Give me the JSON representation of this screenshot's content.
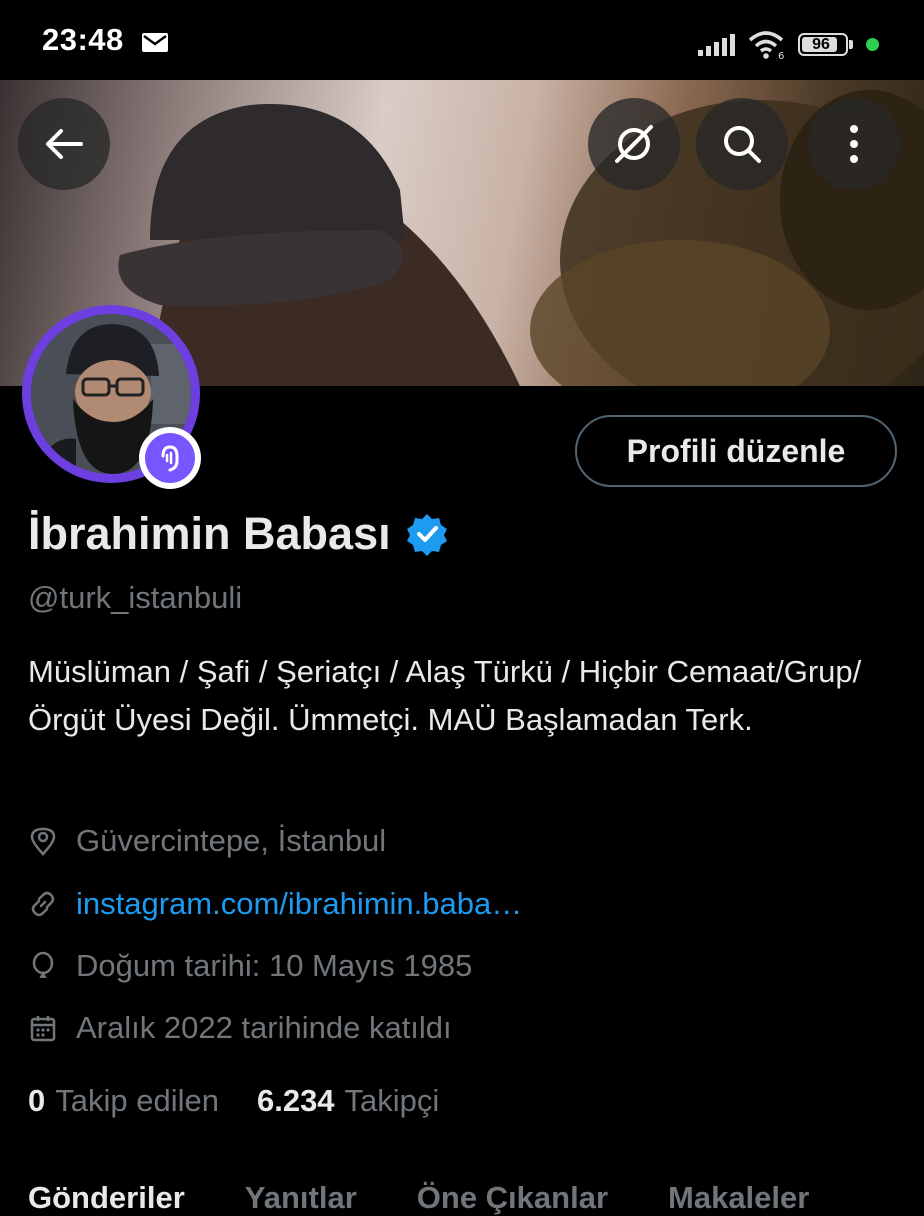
{
  "status_bar": {
    "time": "23:48",
    "battery": "96",
    "icons": [
      "mail-icon",
      "signal-icon",
      "wifi-icon",
      "battery-icon"
    ]
  },
  "header": {
    "icons": [
      "back-arrow-icon",
      "grok-icon",
      "search-icon",
      "more-vertical-icon"
    ]
  },
  "profile": {
    "edit_button": "Profili düzenle",
    "name": "İbrahimin Babası",
    "handle": "@turk_istanbuli",
    "bio": "Müslüman / Şafi / Şeriatçı / Alaş Türkü / Hiçbir Cemaat/Grup/Örgüt Üyesi Değil. Ümmetçi. MAÜ Başlamadan Terk.",
    "location": "Güvercintepe, İstanbul",
    "link": "instagram.com/ibrahimin.baba…",
    "birth": "Doğum tarihi: 10 Mayıs 1985",
    "joined": "Aralık 2022 tarihinde katıldı",
    "following_count": "0",
    "following_label": "Takip edilen",
    "followers_count": "6.234",
    "followers_label": "Takipçi"
  },
  "tabs": [
    "Gönderiler",
    "Yanıtlar",
    "Öne Çıkanlar",
    "Makaleler"
  ],
  "colors": {
    "background": "#000000",
    "accent": "#1d9bf0",
    "muted": "#71767b",
    "avatar_ring": "#6d3fe0",
    "spaces": "#7856ff"
  }
}
